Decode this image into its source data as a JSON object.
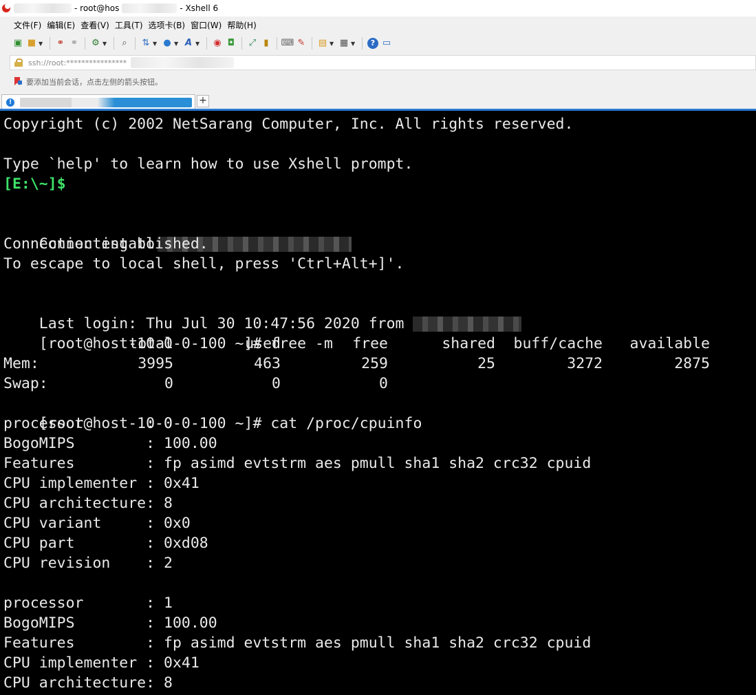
{
  "titlebar": {
    "session_title": "- root@hos",
    "app_name": "- Xshell 6"
  },
  "menu": [
    {
      "label": "文件(F)"
    },
    {
      "label": "编辑(E)"
    },
    {
      "label": "查看(V)"
    },
    {
      "label": "工具(T)"
    },
    {
      "label": "选项卡(B)"
    },
    {
      "label": "窗口(W)"
    },
    {
      "label": "帮助(H)"
    }
  ],
  "toolbar": {
    "icons": [
      "new-session-icon",
      "open-folder-icon",
      "reconnect-icon",
      "disconnect-icon",
      "properties-icon",
      "find-icon",
      "transfer-icon",
      "globe-icon",
      "font-icon",
      "xftp-icon",
      "xmanager-icon",
      "fullscreen-icon",
      "lock-icon",
      "keyboard-icon",
      "highlight-icon",
      "compose-icon",
      "layout-icon",
      "help-icon",
      "chat-icon"
    ]
  },
  "address": {
    "value": "ssh://root:****************"
  },
  "hint": {
    "text": "要添加当前会话，点击左侧的箭头按钮。"
  },
  "tabs": {
    "status_glyph": "!",
    "add_label": "+"
  },
  "terminal": {
    "copyright": "Copyright (c) 2002 NetSarang Computer, Inc. All rights reserved.",
    "help_line": "Type `help' to learn how to use Xshell prompt.",
    "local_prompt": "[E:\\~]$",
    "connecting": "Connecting to",
    "established": "Connection established.",
    "escape_hint": "To escape to local shell, press 'Ctrl+Alt+]'.",
    "last_login": "Last login: Thu Jul 30 10:47:56 2020 from",
    "prompt": "[root@host-10-0-0-100 ~]#",
    "cmd_free": " free -m",
    "free_table": {
      "headers": [
        "total",
        "used",
        "free",
        "shared",
        "buff/cache",
        "available"
      ],
      "rows": [
        {
          "label": "Mem:",
          "values": [
            "3995",
            "463",
            "259",
            "25",
            "3272",
            "2875"
          ]
        },
        {
          "label": "Swap:",
          "values": [
            "0",
            "0",
            "0",
            "",
            "",
            ""
          ]
        }
      ]
    },
    "cmd_cpuinfo": " cat /proc/cpuinfo",
    "cpu0": [
      "processor       : 0",
      "BogoMIPS        : 100.00",
      "Features        : fp asimd evtstrm aes pmull sha1 sha2 crc32 cpuid",
      "CPU implementer : 0x41",
      "CPU architecture: 8",
      "CPU variant     : 0x0",
      "CPU part        : 0xd08",
      "CPU revision    : 2"
    ],
    "cpu1": [
      "processor       : 1",
      "BogoMIPS        : 100.00",
      "Features        : fp asimd evtstrm aes pmull sha1 sha2 crc32 cpuid",
      "CPU implementer : 0x41",
      "CPU architecture: 8"
    ]
  }
}
